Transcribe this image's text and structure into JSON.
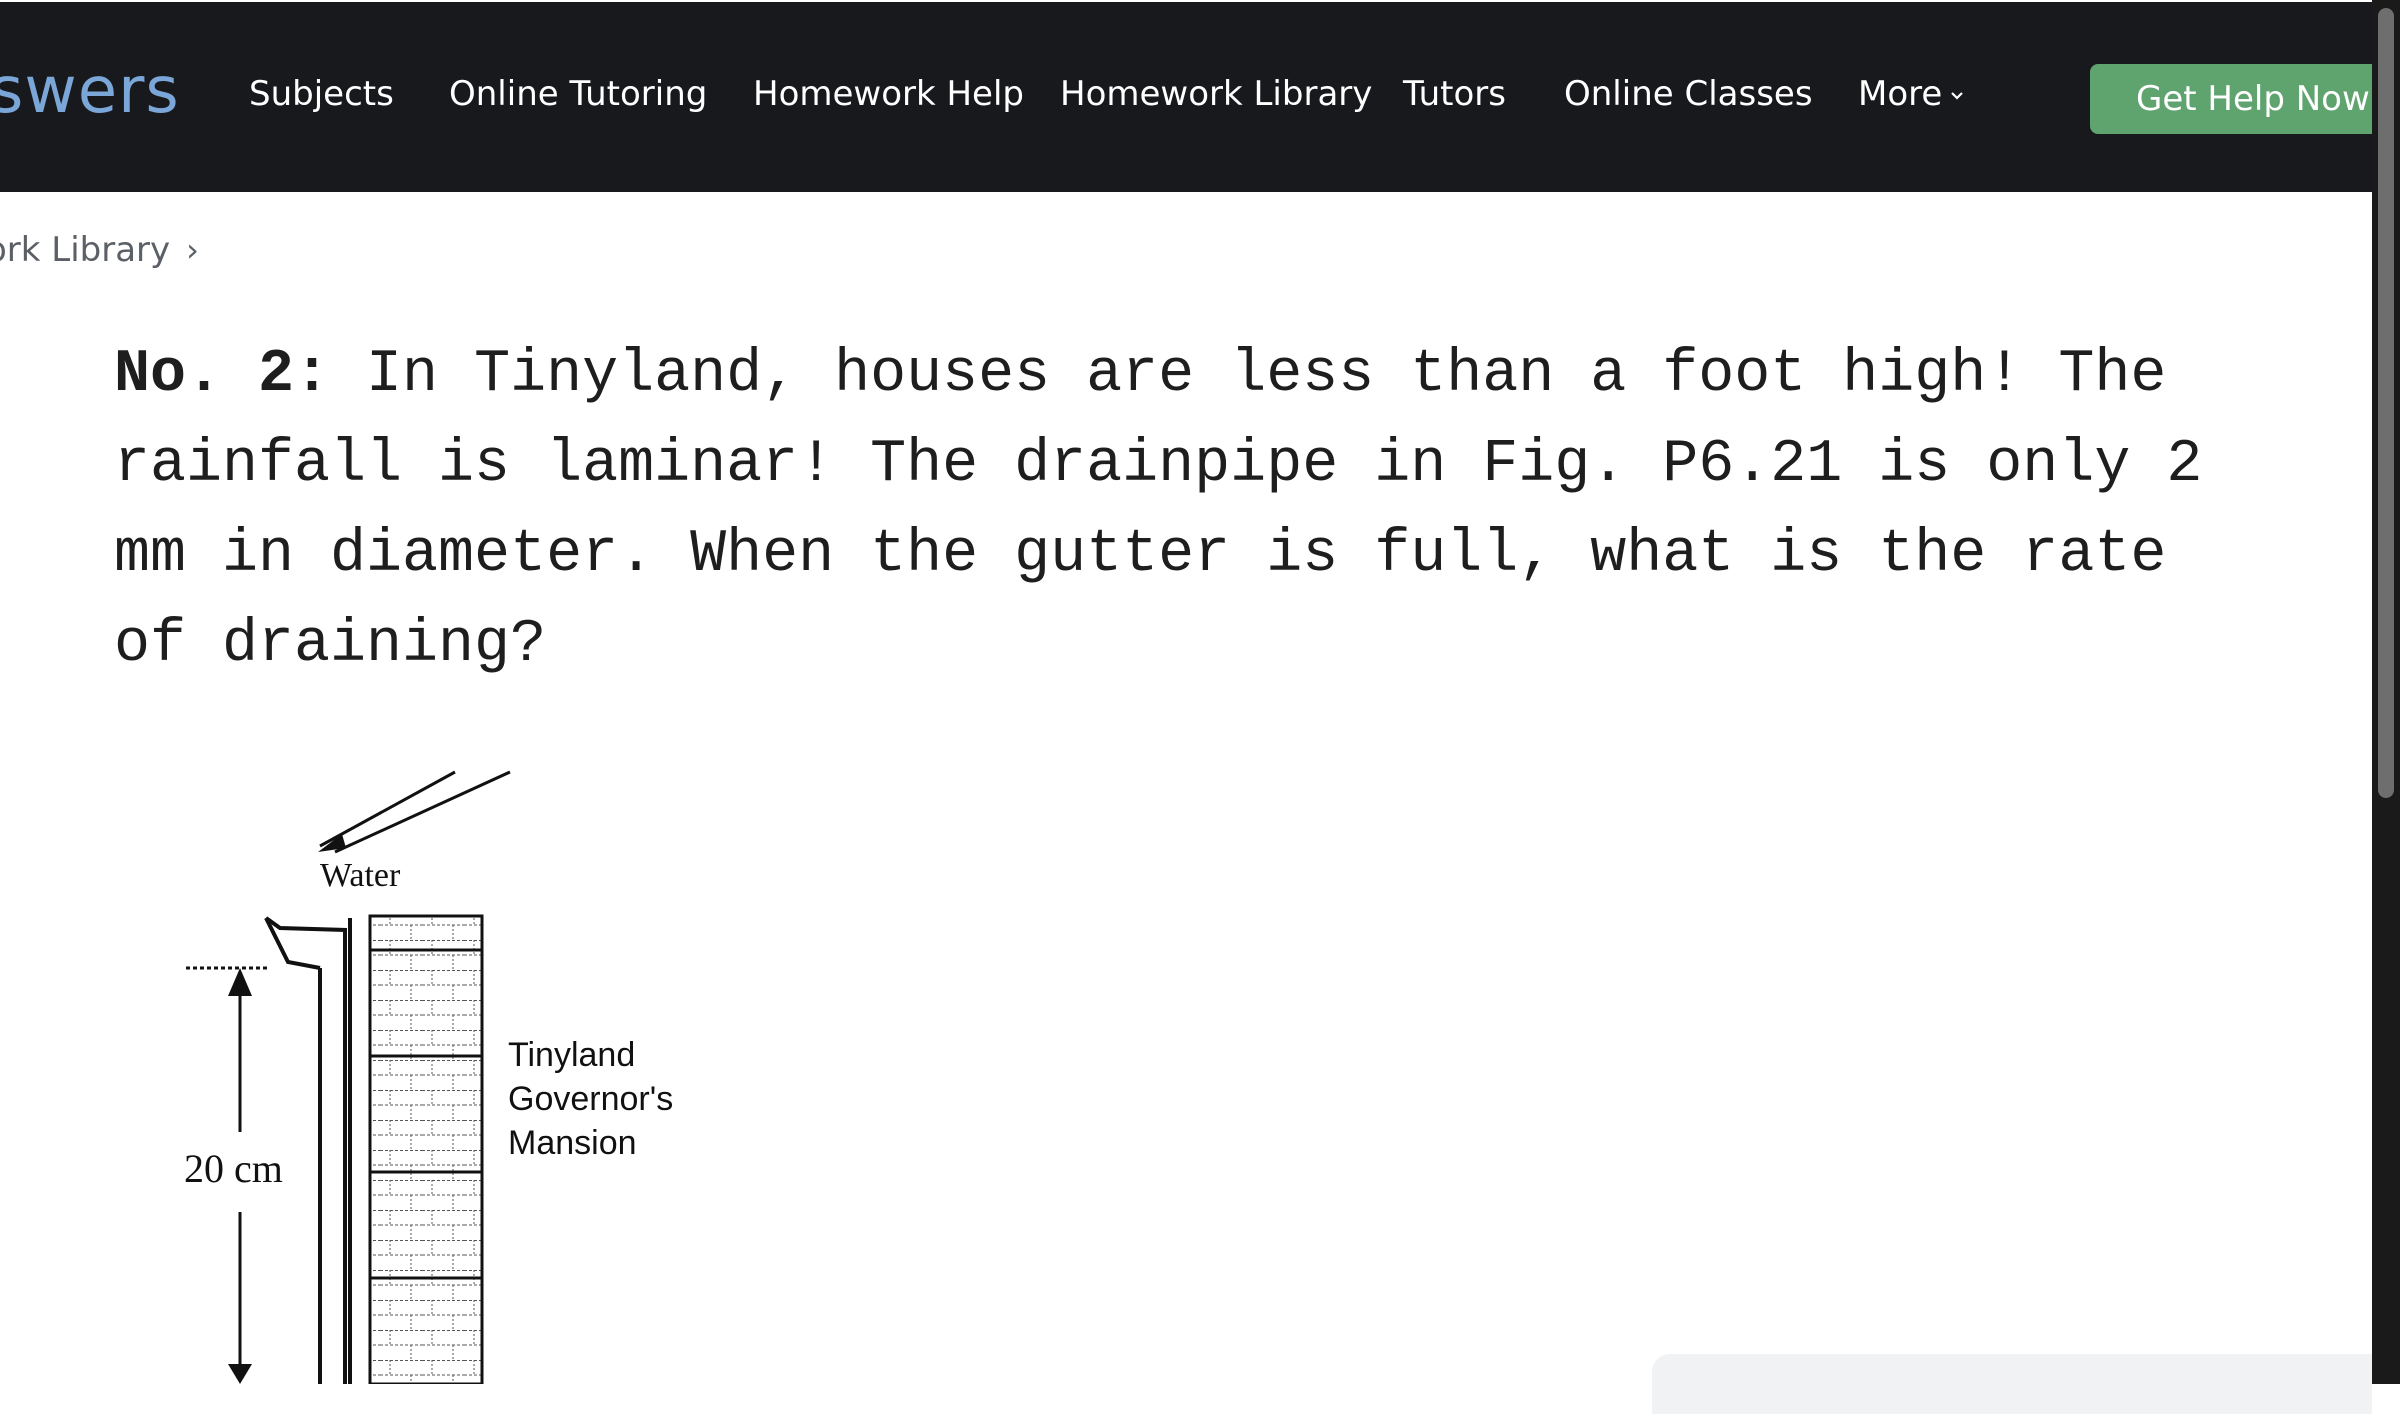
{
  "header": {
    "logo_text": "swers",
    "nav": [
      "Subjects",
      "Online Tutoring",
      "Homework Help",
      "Homework Library",
      "Tutors",
      "Online Classes",
      "More"
    ],
    "cta_label": "Get Help Now"
  },
  "breadcrumb": {
    "current": "ork Library",
    "separator": "›"
  },
  "question": {
    "number": "No. 2:",
    "text": " In Tinyland, houses are less than a foot high! The rainfall is laminar! The drainpipe in Fig. P6.21 is only 2 mm in diameter. When the gutter is full, what is the rate of draining?"
  },
  "figure": {
    "water_label": "Water",
    "height_label": "20 cm",
    "house_label_lines": [
      "Tinyland",
      "Governor's",
      "Mansion"
    ]
  },
  "colors": {
    "header_bg": "#18191d",
    "logo": "#7ba6d8",
    "cta_bg": "#5fa36f",
    "text": "#1e1e1e"
  }
}
